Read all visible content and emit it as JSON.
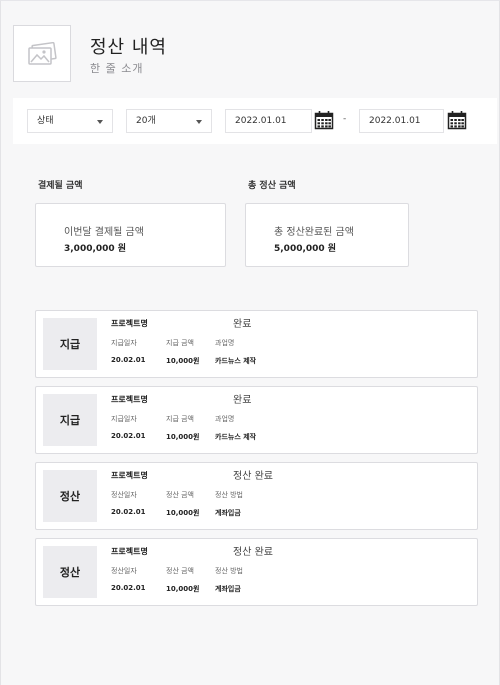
{
  "header": {
    "title": "정산 내역",
    "subtitle": "한 줄 소개",
    "thumbnail_icon": "image-placeholder-icon"
  },
  "filters": {
    "status_label": "상태",
    "count_label": "20개",
    "start_date": "2022.01.01",
    "separator": "-",
    "end_date": "2022.01.01",
    "calendar_icon": "calendar-icon"
  },
  "summary": {
    "left": {
      "section_label": "결제될 금액",
      "card_label": "이번달 결제될 금액",
      "card_value": "3,000,000 원"
    },
    "right": {
      "section_label": "총 정산 금액",
      "card_label": "총 정산완료된 금액",
      "card_value": "5,000,000 원"
    }
  },
  "items": [
    {
      "badge": "지급",
      "project": "프로젝트명",
      "status": "완료",
      "col1_header": "지급일자",
      "col1_value": "20.02.01",
      "col2_header": "지급 금액",
      "col2_value": "10,000원",
      "col3_header": "과업명",
      "col3_value": "카드뉴스 제작"
    },
    {
      "badge": "지급",
      "project": "프로젝트명",
      "status": "완료",
      "col1_header": "지급일자",
      "col1_value": "20.02.01",
      "col2_header": "지급 금액",
      "col2_value": "10,000원",
      "col3_header": "과업명",
      "col3_value": "카드뉴스 제작"
    },
    {
      "badge": "정산",
      "project": "프로젝트명",
      "status": "정산 완료",
      "col1_header": "정산일자",
      "col1_value": "20.02.01",
      "col2_header": "정산 금액",
      "col2_value": "10,000원",
      "col3_header": "정산 방법",
      "col3_value": "계좌입금"
    },
    {
      "badge": "정산",
      "project": "프로젝트명",
      "status": "정산 완료",
      "col1_header": "정산일자",
      "col1_value": "20.02.01",
      "col2_header": "정산 금액",
      "col2_value": "10,000원",
      "col3_header": "정산 방법",
      "col3_value": "계좌입금"
    }
  ]
}
